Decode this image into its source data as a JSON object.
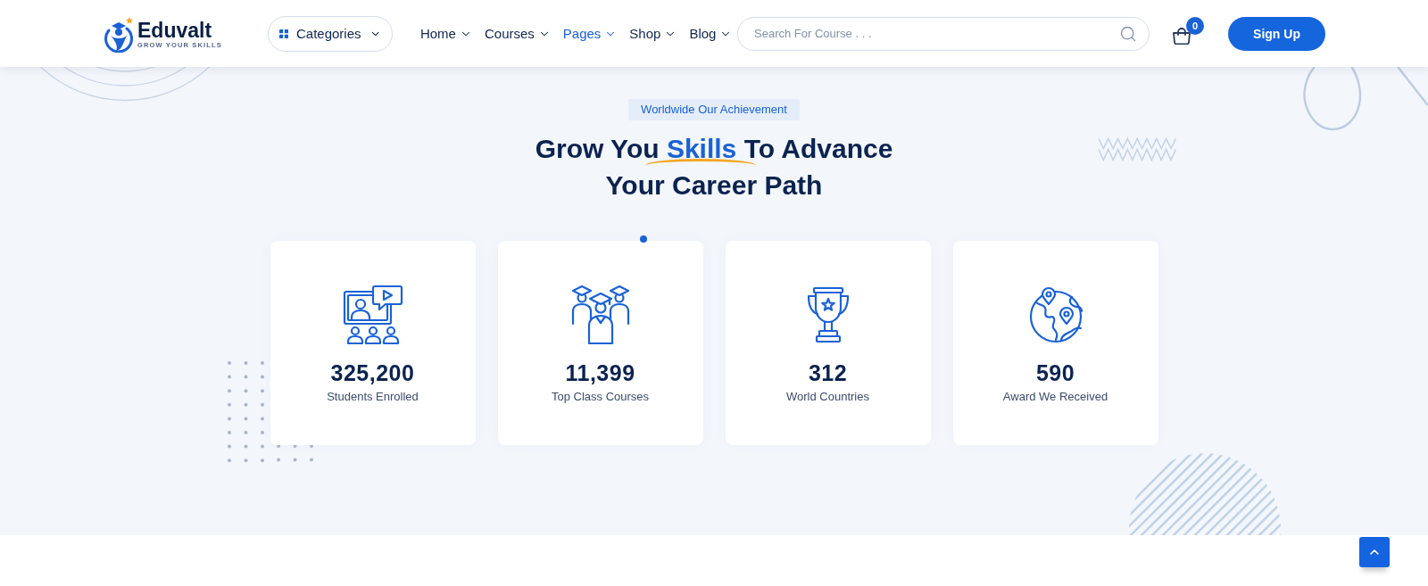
{
  "header": {
    "logo": {
      "name": "Eduvalt",
      "tagline": "GROW YOUR SKILLS"
    },
    "categories": {
      "label": "Categories"
    },
    "nav": [
      {
        "label": "Home",
        "selected": false
      },
      {
        "label": "Courses",
        "selected": false
      },
      {
        "label": "Pages",
        "selected": true
      },
      {
        "label": "Shop",
        "selected": false
      },
      {
        "label": "Blog",
        "selected": false
      }
    ],
    "search": {
      "placeholder": "Search For Course . . ."
    },
    "cart": {
      "count": "0"
    },
    "sign_up": {
      "label": "Sign Up"
    }
  },
  "achievement": {
    "tag": "Worldwide Our Achievement",
    "heading": {
      "lines": [
        {
          "parts": [
            {
              "text": "Grow You",
              "highlight": false
            },
            {
              "text": "Skills",
              "highlight": true
            },
            {
              "text": "To Advance",
              "highlight": false
            }
          ]
        },
        {
          "parts": [
            {
              "text": "Your Career Path",
              "highlight": false
            }
          ]
        }
      ]
    },
    "stats": [
      {
        "kind": "classroom",
        "value": "325,200",
        "label": "Students Enrolled"
      },
      {
        "kind": "graduates",
        "value": "11,399",
        "label": "Top Class Courses"
      },
      {
        "kind": "trophy",
        "value": "312",
        "label": "World Countries"
      },
      {
        "kind": "globe",
        "value": "590",
        "label": "Award We Received"
      }
    ]
  }
}
